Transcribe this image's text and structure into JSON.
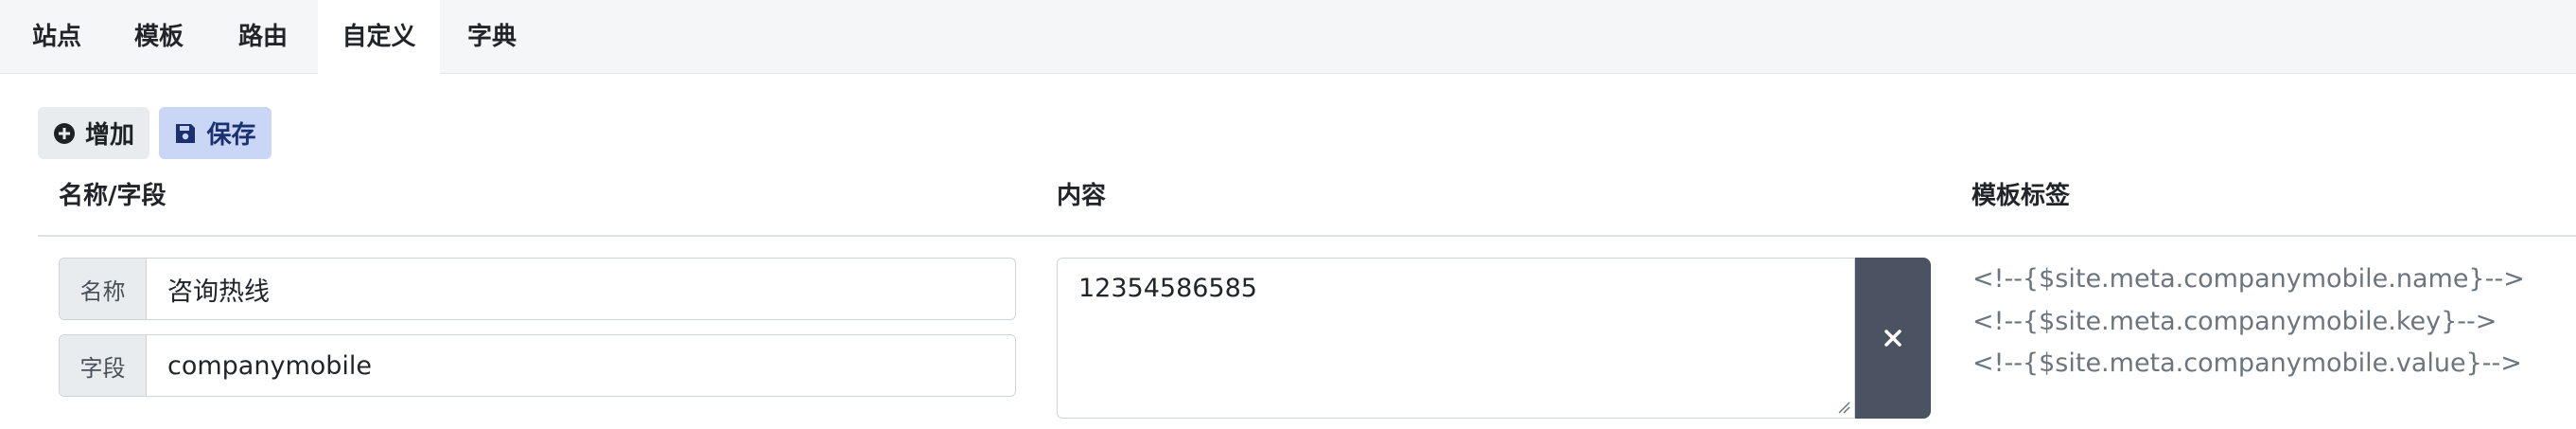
{
  "tabs": [
    {
      "label": "站点"
    },
    {
      "label": "模板"
    },
    {
      "label": "路由"
    },
    {
      "label": "自定义",
      "active": true
    },
    {
      "label": "字典"
    }
  ],
  "toolbar": {
    "add_label": "增加",
    "save_label": "保存"
  },
  "columns": {
    "name_field": "名称/字段",
    "content": "内容",
    "template_tag": "模板标签"
  },
  "rows": [
    {
      "name_prefix": "名称",
      "name_value": "咨询热线",
      "field_prefix": "字段",
      "field_value": "companymobile",
      "content": "12354586585",
      "tags": [
        "<!--{$site.meta.companymobile.name}-->",
        "<!--{$site.meta.companymobile.key}-->",
        "<!--{$site.meta.companymobile.value}-->"
      ]
    }
  ],
  "colors": {
    "tab_bar_bg": "#f5f6f7",
    "add_button_bg": "#e9ecef",
    "save_button_bg": "#c9d6f5",
    "delete_button_bg": "#4b5363",
    "tag_text": "#6c757d"
  },
  "icons": {
    "add": "plus-circle-icon",
    "save": "floppy-disk-icon",
    "delete": "close-icon"
  }
}
